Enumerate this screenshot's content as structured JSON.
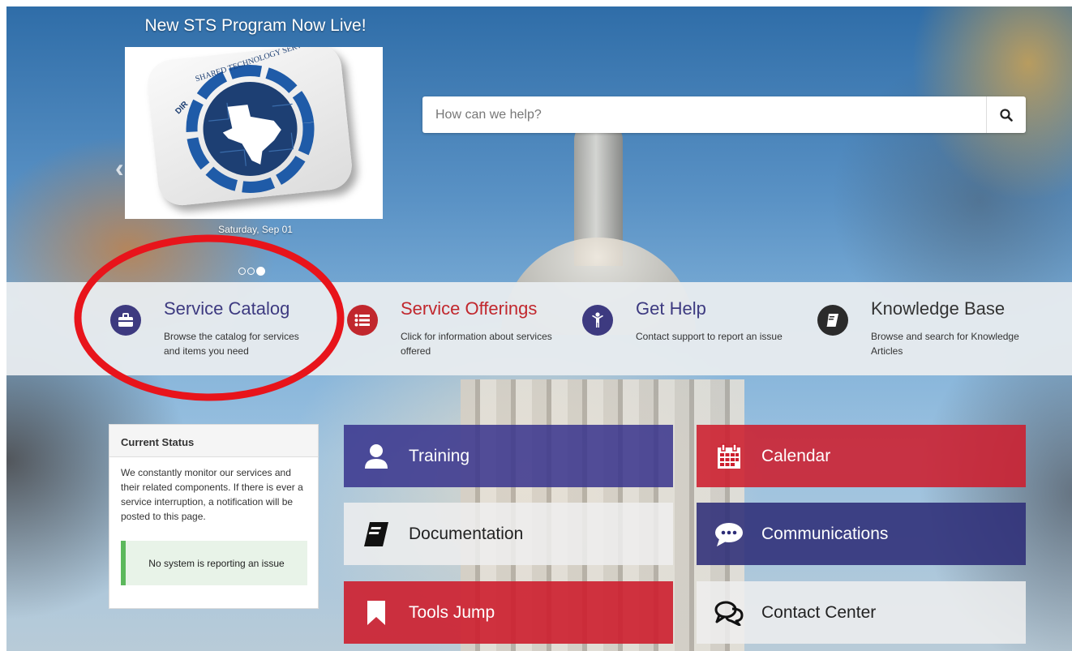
{
  "carousel": {
    "title": "New STS Program Now Live!",
    "slide_logo_text": "SHARED TECHNOLOGY SERVICES · DIR",
    "date": "Saturday, Sep 01",
    "prev_icon": "chevron-left-icon",
    "next_icon": "chevron-right-icon",
    "dots": 3,
    "active_dot": 3
  },
  "search": {
    "placeholder": "How can we help?",
    "icon": "search-icon"
  },
  "tiles": [
    {
      "title": "Service Catalog",
      "desc": "Browse the catalog for services and items you need",
      "icon": "briefcase-icon",
      "icon_bg": "#3d3a80",
      "title_color": "#3d3a80"
    },
    {
      "title": "Service Offerings",
      "desc": "Click for information about services offered",
      "icon": "list-icon",
      "icon_bg": "#c1272d",
      "title_color": "#c1272d"
    },
    {
      "title": "Get Help",
      "desc": "Contact support to report an issue",
      "icon": "person-help-icon",
      "icon_bg": "#3d3a80",
      "title_color": "#3d3a80"
    },
    {
      "title": "Knowledge Base",
      "desc": "Browse and search for Knowledge Articles",
      "icon": "book-icon",
      "icon_bg": "#2b2b2b",
      "title_color": "#333333"
    }
  ],
  "status": {
    "heading": "Current Status",
    "body": "We constantly monitor our services and their related components. If there is ever a service interruption, a notification will be posted to this page.",
    "ok_message": "No system is reporting an issue",
    "ok_color": "#5cb85c"
  },
  "buttons": [
    {
      "label": "Training",
      "icon": "user-icon",
      "bg": "rgba(55,50,140,0.85)",
      "theme": "dark"
    },
    {
      "label": "Calendar",
      "icon": "calendar-icon",
      "bg": "rgba(205,30,45,0.88)",
      "theme": "dark"
    },
    {
      "label": "Documentation",
      "icon": "book-icon",
      "bg": "rgba(238,238,238,0.85)",
      "theme": "light"
    },
    {
      "label": "Communications",
      "icon": "chat-bubble-icon",
      "bg": "rgba(45,45,120,0.88)",
      "theme": "dark"
    },
    {
      "label": "Tools Jump",
      "icon": "bookmark-icon",
      "bg": "rgba(205,30,45,0.9)",
      "theme": "dark"
    },
    {
      "label": "Contact Center",
      "icon": "conversation-icon",
      "bg": "rgba(238,238,238,0.85)",
      "theme": "light"
    }
  ],
  "annotation": {
    "shape": "ellipse",
    "color": "#e8141b",
    "target": "Service Catalog"
  }
}
